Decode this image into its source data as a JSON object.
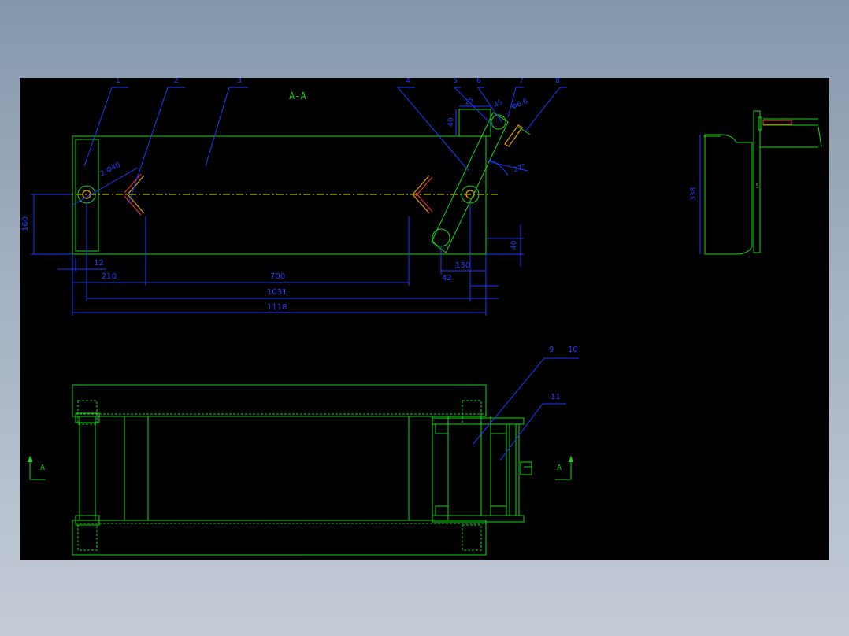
{
  "drawing": {
    "section_title": "A-A",
    "part_numbers": [
      "1",
      "2",
      "3",
      "4",
      "5",
      "6",
      "7",
      "8",
      "9",
      "10",
      "11"
    ],
    "dimensions": {
      "hole_spec": "2-Φ40",
      "height_left": "160",
      "offset_12": "12",
      "d_210": "210",
      "d_700": "700",
      "d_1031": "1031",
      "d_1118": "1118",
      "d_130": "130",
      "d_42": "42",
      "d_40": "40",
      "top_25": "25",
      "top_40": "40",
      "top_phi": "Φ6.6",
      "top_45": "45",
      "angle": "27°",
      "side_height": "338"
    },
    "section_markers": [
      {
        "label": "A"
      },
      {
        "label": "A"
      }
    ]
  }
}
